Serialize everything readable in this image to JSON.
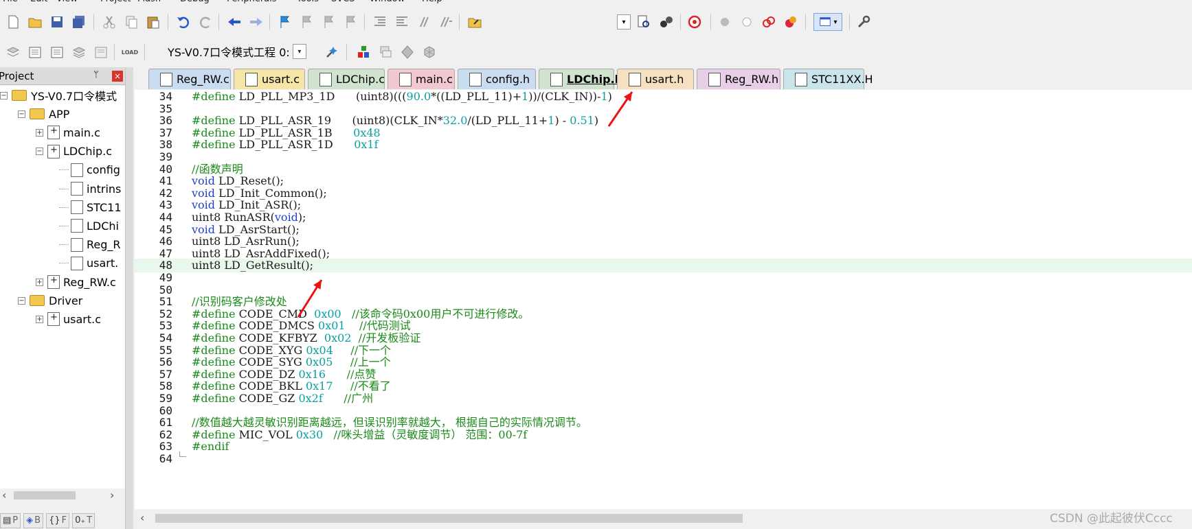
{
  "menu": [
    "File",
    "Edit",
    "View",
    "Project",
    "Flash",
    "Debug",
    "Peripherals",
    "Tools",
    "SVCS",
    "Window",
    "Help"
  ],
  "toolbar2": {
    "load_label": "LOAD",
    "target_name": "YS-V0.7口令模式工程 0:"
  },
  "project_panel": {
    "title": "Project",
    "pin": "ᛘ",
    "close": "×",
    "tree": [
      {
        "label": "YS-V0.7口令模式",
        "expander": "−"
      },
      {
        "label": "APP",
        "expander": "−"
      },
      {
        "label": "main.c",
        "expander": "+"
      },
      {
        "label": "LDChip.c",
        "expander": "−"
      },
      {
        "label": "config"
      },
      {
        "label": "intrins"
      },
      {
        "label": "STC11"
      },
      {
        "label": "LDChi"
      },
      {
        "label": "Reg_R"
      },
      {
        "label": "usart."
      },
      {
        "label": "Reg_RW.c",
        "expander": "+"
      },
      {
        "label": "Driver",
        "expander": "−"
      },
      {
        "label": "usart.c",
        "expander": "+"
      }
    ],
    "bottom_tabs": [
      "P",
      "B",
      "F",
      "T"
    ]
  },
  "tabs": [
    {
      "label": "Reg_RW.c",
      "color": "#c9dcf0"
    },
    {
      "label": "usart.c",
      "color": "#f5e6a8"
    },
    {
      "label": "LDChip.c",
      "color": "#cfe3cf"
    },
    {
      "label": "main.c",
      "color": "#f3c7cf"
    },
    {
      "label": "config.h",
      "color": "#c9dcf0"
    },
    {
      "label": "LDChip.h",
      "color": "#cfe3cf",
      "active": true
    },
    {
      "label": "usart.h",
      "color": "#f5e0c0"
    },
    {
      "label": "Reg_RW.h",
      "color": "#e8cfe8"
    },
    {
      "label": "STC11XX.H",
      "color": "#c9e4ea"
    }
  ],
  "editor": {
    "highlight_line": 48,
    "lines": [
      {
        "n": "34",
        "t": "#define LD_PLL_MP3_1D      (uint8)(((90.0*((LD_PLL_11)+1))/(CLK_IN))-1)"
      },
      {
        "n": "35",
        "t": ""
      },
      {
        "n": "36",
        "t": "#define LD_PLL_ASR_19      (uint8)(CLK_IN*32.0/(LD_PLL_11+1) - 0.51)"
      },
      {
        "n": "37",
        "t": "#define LD_PLL_ASR_1B      0x48"
      },
      {
        "n": "38",
        "t": "#define LD_PLL_ASR_1D      0x1f"
      },
      {
        "n": "39",
        "t": ""
      },
      {
        "n": "40",
        "t": "//函数声明"
      },
      {
        "n": "41",
        "t": "void LD_Reset();"
      },
      {
        "n": "42",
        "t": "void LD_Init_Common();"
      },
      {
        "n": "43",
        "t": "void LD_Init_ASR();"
      },
      {
        "n": "44",
        "t": "uint8 RunASR(void);"
      },
      {
        "n": "45",
        "t": "void LD_AsrStart();"
      },
      {
        "n": "46",
        "t": "uint8 LD_AsrRun();"
      },
      {
        "n": "47",
        "t": "uint8 LD_AsrAddFixed();"
      },
      {
        "n": "48",
        "t": "uint8 LD_GetResult();"
      },
      {
        "n": "49",
        "t": ""
      },
      {
        "n": "50",
        "t": ""
      },
      {
        "n": "51",
        "t": "//识别码客户修改处"
      },
      {
        "n": "52",
        "t": "#define CODE_CMD  0x00   //该命令码0x00用户不可进行修改。"
      },
      {
        "n": "53",
        "t": "#define CODE_DMCS 0x01    //代码测试"
      },
      {
        "n": "54",
        "t": "#define CODE_KFBYZ  0x02  //开发板验证"
      },
      {
        "n": "55",
        "t": "#define CODE_XYG 0x04     //下一个"
      },
      {
        "n": "56",
        "t": "#define CODE_SYG 0x05     //上一个"
      },
      {
        "n": "57",
        "t": "#define CODE_DZ 0x16      //点赞"
      },
      {
        "n": "58",
        "t": "#define CODE_BKL 0x17     //不看了"
      },
      {
        "n": "59",
        "t": "#define CODE_GZ 0x2f      //广州"
      },
      {
        "n": "60",
        "t": ""
      },
      {
        "n": "61",
        "t": "//数值越大越灵敏识别距离越远，但误识别率就越大， 根据自己的实际情况调节。"
      },
      {
        "n": "62",
        "t": "#define MIC_VOL 0x30   //咪头增益（灵敏度调节） 范围：00-7f"
      },
      {
        "n": "63",
        "t": "#endif"
      },
      {
        "n": "64",
        "t": ""
      }
    ]
  },
  "colors": {
    "keyword": "#1f3fd1",
    "number": "#0aa0a0",
    "comment": "#1a8a1a",
    "plain": "#1a1a1a"
  },
  "watermark": "CSDN @此起彼伏Cccc"
}
